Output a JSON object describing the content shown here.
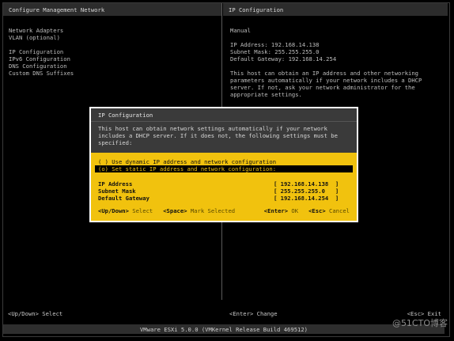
{
  "left": {
    "title": "Configure Management Network",
    "groups": [
      [
        "Network Adapters",
        "VLAN (optional)"
      ],
      [
        "IP Configuration",
        "IPv6 Configuration",
        "DNS Configuration",
        "Custom DNS Suffixes"
      ]
    ]
  },
  "right": {
    "title": "IP Configuration",
    "mode": "Manual",
    "ip_line": "IP Address: 192.168.14.138",
    "mask_line": "Subnet Mask: 255.255.255.0",
    "gw_line": "Default Gateway: 192.168.14.254",
    "info_lines": [
      "This host can obtain an IP address and other networking",
      "parameters automatically if your network includes a DHCP",
      "server. If not, ask your network administrator for the",
      "appropriate settings."
    ]
  },
  "dialog": {
    "title": "IP Configuration",
    "desc_lines": [
      "This host can obtain network settings automatically if your network",
      "includes a DHCP server. If it does not, the following settings must be",
      "specified:"
    ],
    "options": [
      "( ) Use dynamic IP address and network configuration",
      "(o) Set static IP address and network configuration:"
    ],
    "selected_index": 1,
    "fields": [
      {
        "label": "IP Address",
        "value": "[ 192.168.14.138  ]"
      },
      {
        "label": "Subnet Mask",
        "value": "[ 255.255.255.0   ]"
      },
      {
        "label": "Default Gateway",
        "value": "[ 192.168.14.254  ]"
      }
    ],
    "keys": {
      "updown_key": "<Up/Down>",
      "updown_desc": "Select",
      "space_key": "<Space>",
      "space_desc": "Mark Selected",
      "enter_key": "<Enter>",
      "enter_desc": "OK",
      "esc_key": "<Esc>",
      "esc_desc": "Cancel"
    }
  },
  "footer": {
    "left": "<Up/Down> Select",
    "middle": "<Enter> Change",
    "right": "<Esc> Exit"
  },
  "status_bar": "VMware ESXi 5.0.0 (VMKernel Release Build 469512)",
  "watermark": "@51CTO博客"
}
